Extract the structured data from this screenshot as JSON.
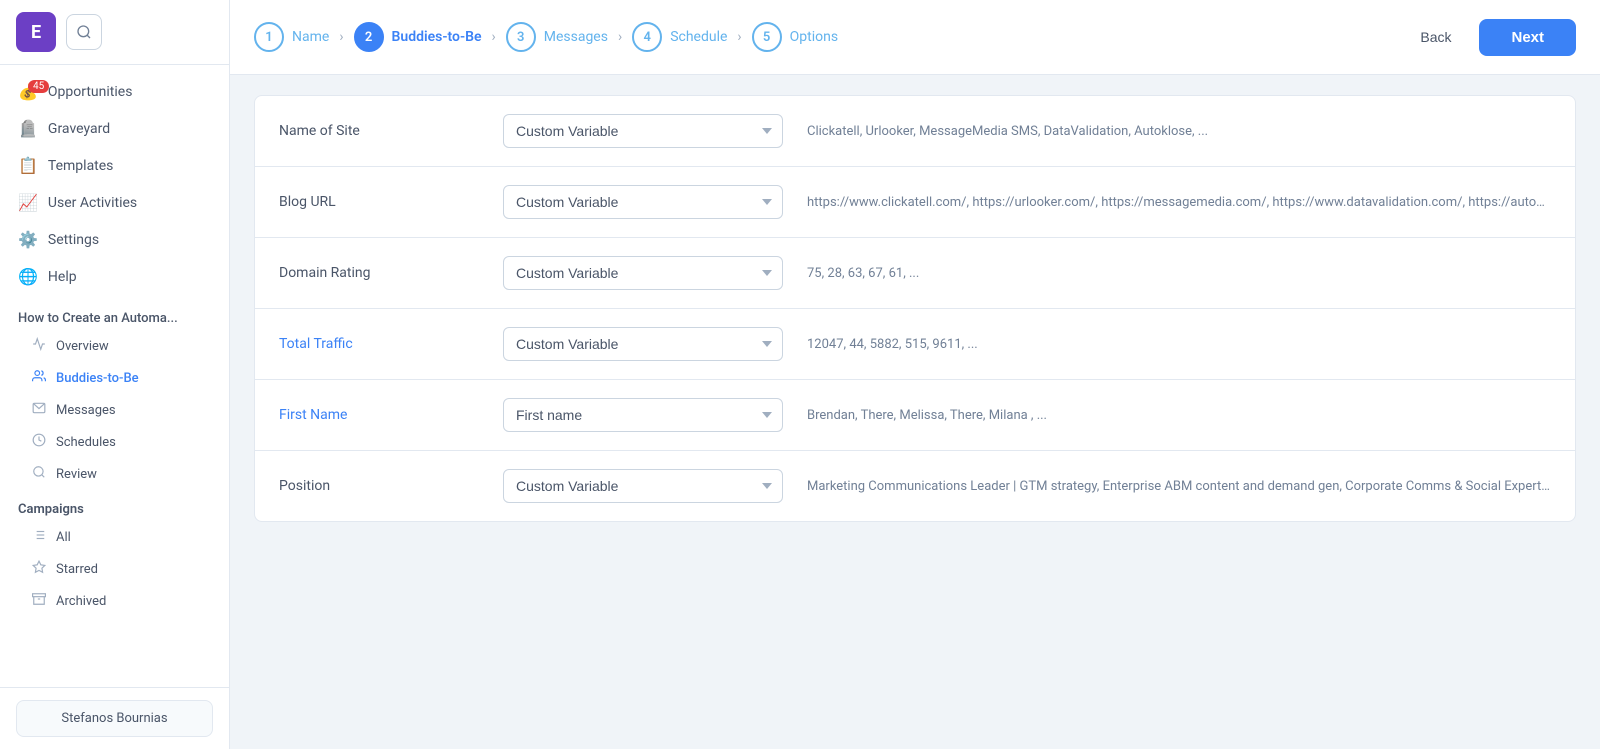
{
  "sidebar": {
    "logo_letter": "E",
    "nav_items": [
      {
        "id": "opportunities",
        "label": "Opportunities",
        "icon": "💰",
        "badge": "45"
      },
      {
        "id": "graveyard",
        "label": "Graveyard",
        "icon": "🪦",
        "badge": null
      },
      {
        "id": "templates",
        "label": "Templates",
        "icon": "📋",
        "badge": null
      },
      {
        "id": "user-activities",
        "label": "User Activities",
        "icon": "📈",
        "badge": null
      },
      {
        "id": "settings",
        "label": "Settings",
        "icon": "⚙️",
        "badge": null
      },
      {
        "id": "help",
        "label": "Help",
        "icon": "🌐",
        "badge": null
      }
    ],
    "how_to_title": "How to Create an Automa...",
    "sub_nav": [
      {
        "id": "overview",
        "label": "Overview",
        "icon": "📊",
        "active": false
      },
      {
        "id": "buddies-to-be",
        "label": "Buddies-to-Be",
        "icon": "👥",
        "active": true
      },
      {
        "id": "messages",
        "label": "Messages",
        "icon": "✉️",
        "active": false
      },
      {
        "id": "schedules",
        "label": "Schedules",
        "icon": "🕐",
        "active": false
      },
      {
        "id": "review",
        "label": "Review",
        "icon": "🔍",
        "active": false
      }
    ],
    "campaigns_title": "Campaigns",
    "campaign_items": [
      {
        "id": "all",
        "label": "All",
        "icon": "☰"
      },
      {
        "id": "starred",
        "label": "Starred",
        "icon": "☆"
      },
      {
        "id": "archived",
        "label": "Archived",
        "icon": "🗄"
      }
    ],
    "user_name": "Stefanos Bournias"
  },
  "wizard": {
    "steps": [
      {
        "id": 1,
        "label": "Name",
        "active": false
      },
      {
        "id": 2,
        "label": "Buddies-to-Be",
        "active": true
      },
      {
        "id": 3,
        "label": "Messages",
        "active": false
      },
      {
        "id": 4,
        "label": "Schedule",
        "active": false
      },
      {
        "id": 5,
        "label": "Options",
        "active": false
      }
    ],
    "back_label": "Back",
    "next_label": "Next"
  },
  "fields": [
    {
      "id": "name-of-site",
      "label": "Name of Site",
      "label_color": "normal",
      "select_value": "Custom Variable",
      "preview": "Clickatell, Urlooker, MessageMedia SMS, DataValidation, Autoklose, ..."
    },
    {
      "id": "blog-url",
      "label": "Blog URL",
      "label_color": "normal",
      "select_value": "Custom Variable",
      "preview": "https://www.clickatell.com/, https://urlooker.com/, https://messagemedia.com/, https://www.datavalidation.com/, https://autoklose.com/, ..."
    },
    {
      "id": "domain-rating",
      "label": "Domain Rating",
      "label_color": "normal",
      "select_value": "Custom Variable",
      "preview": "75, 28, 63, 67, 61, ..."
    },
    {
      "id": "total-traffic",
      "label": "Total Traffic",
      "label_color": "blue",
      "select_value": "Custom Variable",
      "preview": "12047, 44, 5882, 515, 9611, ..."
    },
    {
      "id": "first-name",
      "label": "First Name",
      "label_color": "blue",
      "select_value": "First name",
      "preview": "Brendan, There, Melissa, There, Milana , ..."
    },
    {
      "id": "position",
      "label": "Position",
      "label_color": "normal",
      "select_value": "Custom Variable",
      "preview": "Marketing Communications Leader | GTM strategy, Enterprise ABM content and demand gen, Corporate Comms & Social Expert, ---, Content Strategist, ---, Head of Marketing, ..."
    }
  ]
}
